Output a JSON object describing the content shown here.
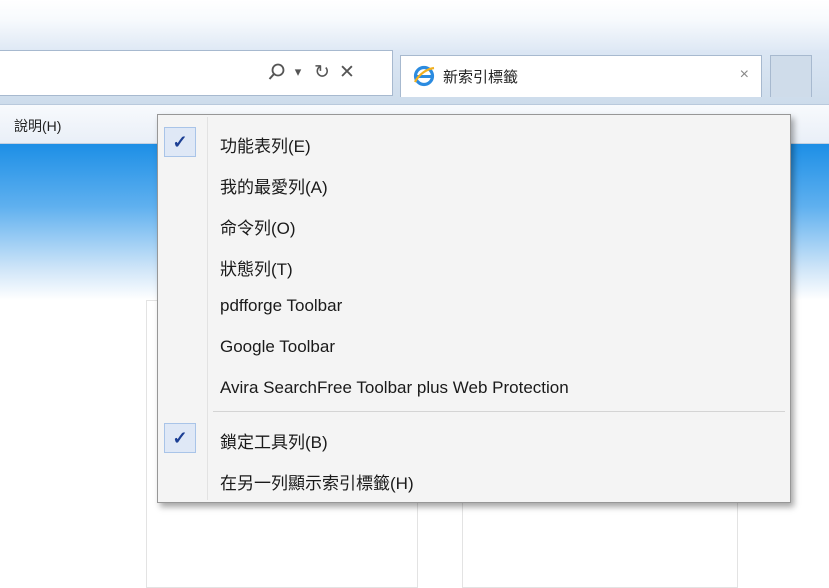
{
  "toolbar": {
    "search_glyph": "⚲",
    "dropdown_glyph": "▾",
    "refresh_glyph": "↻",
    "close_glyph": "✕"
  },
  "tab": {
    "title": "新索引標籤",
    "close_glyph": "×",
    "icon": "ie-icon"
  },
  "menubar": {
    "help": "說明(H)"
  },
  "context_menu": {
    "items": [
      {
        "label": "功能表列(E)",
        "checked": true
      },
      {
        "label": "我的最愛列(A)",
        "checked": false
      },
      {
        "label": "命令列(O)",
        "checked": false
      },
      {
        "label": "狀態列(T)",
        "checked": false
      },
      {
        "label": "pdfforge Toolbar",
        "checked": false
      },
      {
        "label": "Google Toolbar",
        "checked": false
      },
      {
        "label": "Avira SearchFree Toolbar plus Web Protection",
        "checked": false
      },
      {
        "label": "鎖定工具列(B)",
        "checked": true
      },
      {
        "label": "在另一列顯示索引標籤(H)",
        "checked": false
      }
    ],
    "check_glyph": "✓"
  },
  "colors": {
    "accent": "#1d8fe6",
    "check": "#1c3f94"
  }
}
